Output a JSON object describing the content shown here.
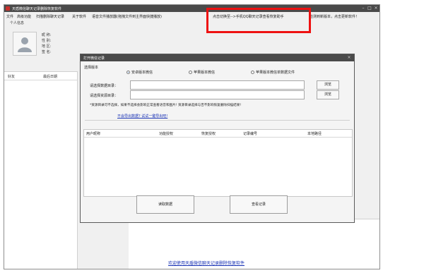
{
  "window": {
    "title": "天盾微信聊天记录删除恢复软件",
    "controls": [
      "–",
      "□",
      "×"
    ]
  },
  "menu": {
    "items": [
      "文件",
      "高级功能",
      "扫描删除聊天记录",
      "关于软件",
      "语音文件播放器(拖拽文件到主界面快捷播放)",
      "点击切换至-->手机QQ聊天记录查看恢复助手",
      "检测到新版本，点击更新软件！"
    ]
  },
  "profile": {
    "section_label": "个人信息",
    "fields": [
      "昵 称:",
      "性 别:",
      "地 区:",
      "签 名:"
    ]
  },
  "left_panel": {
    "col_friend": "好友",
    "col_last_date": "最后日期"
  },
  "footer": {
    "link": "欢迎使用天盾微信聊天记录删除恢复软件"
  },
  "dialog": {
    "title": "打开微信记录",
    "close": "×",
    "group_label": "选择版本",
    "radios": [
      {
        "label": "安卓版本微信",
        "checked": true
      },
      {
        "label": "苹果版本微信",
        "checked": false
      },
      {
        "label": "苹果版本微信单数据文件",
        "checked": false
      }
    ],
    "data_dir_label": "请选择数据目录：",
    "data_dir_value": "",
    "res_dir_label": "请选择资源目录：",
    "res_dir_value": "",
    "browse_label": "浏览",
    "note": "*资源目录可不选择，如果不选择会影响正常查看语音和图片! 资源目录选择与否不影响恢复删除扫描结果!",
    "help_link": "不会导出数据? 试试一键导出吧!",
    "table_headers": [
      "用户昵称",
      "功能授权",
      "恢复授权",
      "记录编号",
      "本地路径"
    ],
    "read_button": "读取数据",
    "view_button": "查看记录"
  },
  "colors": {
    "title_bar": "#4a4a4a",
    "highlight_box": "#e11111",
    "link": "#1a33b5"
  }
}
